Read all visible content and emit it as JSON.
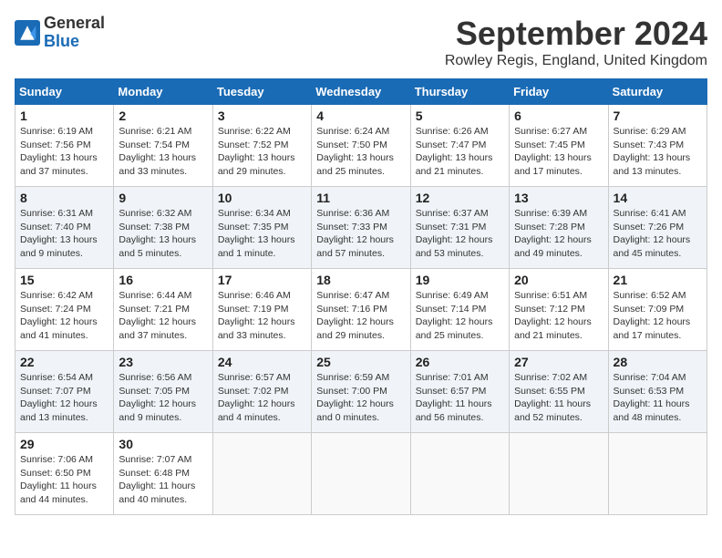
{
  "header": {
    "logo_line1": "General",
    "logo_line2": "Blue",
    "month_title": "September 2024",
    "location": "Rowley Regis, England, United Kingdom"
  },
  "weekdays": [
    "Sunday",
    "Monday",
    "Tuesday",
    "Wednesday",
    "Thursday",
    "Friday",
    "Saturday"
  ],
  "weeks": [
    [
      {
        "day": "1",
        "sunrise": "Sunrise: 6:19 AM",
        "sunset": "Sunset: 7:56 PM",
        "daylight": "Daylight: 13 hours and 37 minutes."
      },
      {
        "day": "2",
        "sunrise": "Sunrise: 6:21 AM",
        "sunset": "Sunset: 7:54 PM",
        "daylight": "Daylight: 13 hours and 33 minutes."
      },
      {
        "day": "3",
        "sunrise": "Sunrise: 6:22 AM",
        "sunset": "Sunset: 7:52 PM",
        "daylight": "Daylight: 13 hours and 29 minutes."
      },
      {
        "day": "4",
        "sunrise": "Sunrise: 6:24 AM",
        "sunset": "Sunset: 7:50 PM",
        "daylight": "Daylight: 13 hours and 25 minutes."
      },
      {
        "day": "5",
        "sunrise": "Sunrise: 6:26 AM",
        "sunset": "Sunset: 7:47 PM",
        "daylight": "Daylight: 13 hours and 21 minutes."
      },
      {
        "day": "6",
        "sunrise": "Sunrise: 6:27 AM",
        "sunset": "Sunset: 7:45 PM",
        "daylight": "Daylight: 13 hours and 17 minutes."
      },
      {
        "day": "7",
        "sunrise": "Sunrise: 6:29 AM",
        "sunset": "Sunset: 7:43 PM",
        "daylight": "Daylight: 13 hours and 13 minutes."
      }
    ],
    [
      {
        "day": "8",
        "sunrise": "Sunrise: 6:31 AM",
        "sunset": "Sunset: 7:40 PM",
        "daylight": "Daylight: 13 hours and 9 minutes."
      },
      {
        "day": "9",
        "sunrise": "Sunrise: 6:32 AM",
        "sunset": "Sunset: 7:38 PM",
        "daylight": "Daylight: 13 hours and 5 minutes."
      },
      {
        "day": "10",
        "sunrise": "Sunrise: 6:34 AM",
        "sunset": "Sunset: 7:35 PM",
        "daylight": "Daylight: 13 hours and 1 minute."
      },
      {
        "day": "11",
        "sunrise": "Sunrise: 6:36 AM",
        "sunset": "Sunset: 7:33 PM",
        "daylight": "Daylight: 12 hours and 57 minutes."
      },
      {
        "day": "12",
        "sunrise": "Sunrise: 6:37 AM",
        "sunset": "Sunset: 7:31 PM",
        "daylight": "Daylight: 12 hours and 53 minutes."
      },
      {
        "day": "13",
        "sunrise": "Sunrise: 6:39 AM",
        "sunset": "Sunset: 7:28 PM",
        "daylight": "Daylight: 12 hours and 49 minutes."
      },
      {
        "day": "14",
        "sunrise": "Sunrise: 6:41 AM",
        "sunset": "Sunset: 7:26 PM",
        "daylight": "Daylight: 12 hours and 45 minutes."
      }
    ],
    [
      {
        "day": "15",
        "sunrise": "Sunrise: 6:42 AM",
        "sunset": "Sunset: 7:24 PM",
        "daylight": "Daylight: 12 hours and 41 minutes."
      },
      {
        "day": "16",
        "sunrise": "Sunrise: 6:44 AM",
        "sunset": "Sunset: 7:21 PM",
        "daylight": "Daylight: 12 hours and 37 minutes."
      },
      {
        "day": "17",
        "sunrise": "Sunrise: 6:46 AM",
        "sunset": "Sunset: 7:19 PM",
        "daylight": "Daylight: 12 hours and 33 minutes."
      },
      {
        "day": "18",
        "sunrise": "Sunrise: 6:47 AM",
        "sunset": "Sunset: 7:16 PM",
        "daylight": "Daylight: 12 hours and 29 minutes."
      },
      {
        "day": "19",
        "sunrise": "Sunrise: 6:49 AM",
        "sunset": "Sunset: 7:14 PM",
        "daylight": "Daylight: 12 hours and 25 minutes."
      },
      {
        "day": "20",
        "sunrise": "Sunrise: 6:51 AM",
        "sunset": "Sunset: 7:12 PM",
        "daylight": "Daylight: 12 hours and 21 minutes."
      },
      {
        "day": "21",
        "sunrise": "Sunrise: 6:52 AM",
        "sunset": "Sunset: 7:09 PM",
        "daylight": "Daylight: 12 hours and 17 minutes."
      }
    ],
    [
      {
        "day": "22",
        "sunrise": "Sunrise: 6:54 AM",
        "sunset": "Sunset: 7:07 PM",
        "daylight": "Daylight: 12 hours and 13 minutes."
      },
      {
        "day": "23",
        "sunrise": "Sunrise: 6:56 AM",
        "sunset": "Sunset: 7:05 PM",
        "daylight": "Daylight: 12 hours and 9 minutes."
      },
      {
        "day": "24",
        "sunrise": "Sunrise: 6:57 AM",
        "sunset": "Sunset: 7:02 PM",
        "daylight": "Daylight: 12 hours and 4 minutes."
      },
      {
        "day": "25",
        "sunrise": "Sunrise: 6:59 AM",
        "sunset": "Sunset: 7:00 PM",
        "daylight": "Daylight: 12 hours and 0 minutes."
      },
      {
        "day": "26",
        "sunrise": "Sunrise: 7:01 AM",
        "sunset": "Sunset: 6:57 PM",
        "daylight": "Daylight: 11 hours and 56 minutes."
      },
      {
        "day": "27",
        "sunrise": "Sunrise: 7:02 AM",
        "sunset": "Sunset: 6:55 PM",
        "daylight": "Daylight: 11 hours and 52 minutes."
      },
      {
        "day": "28",
        "sunrise": "Sunrise: 7:04 AM",
        "sunset": "Sunset: 6:53 PM",
        "daylight": "Daylight: 11 hours and 48 minutes."
      }
    ],
    [
      {
        "day": "29",
        "sunrise": "Sunrise: 7:06 AM",
        "sunset": "Sunset: 6:50 PM",
        "daylight": "Daylight: 11 hours and 44 minutes."
      },
      {
        "day": "30",
        "sunrise": "Sunrise: 7:07 AM",
        "sunset": "Sunset: 6:48 PM",
        "daylight": "Daylight: 11 hours and 40 minutes."
      },
      null,
      null,
      null,
      null,
      null
    ]
  ]
}
